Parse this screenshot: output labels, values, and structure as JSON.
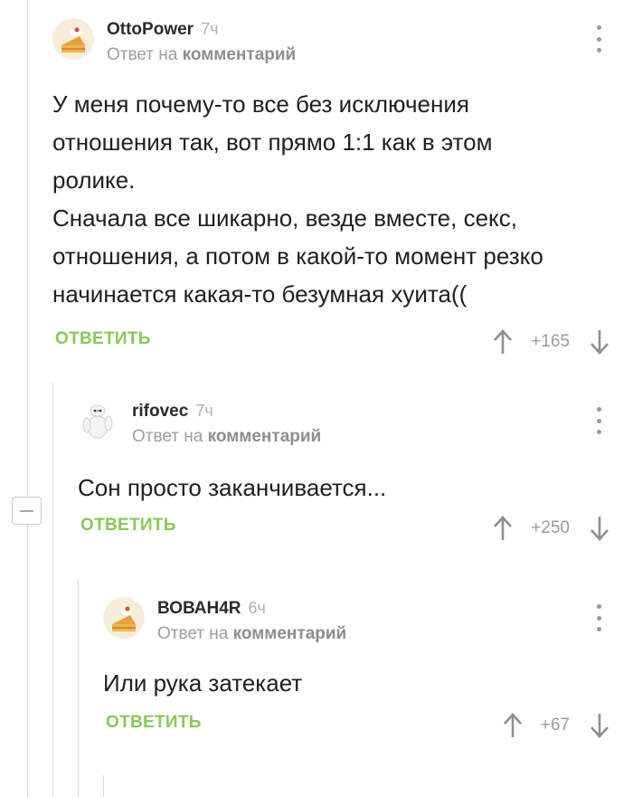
{
  "comments": [
    {
      "username": "OttoPower",
      "time": "7ч",
      "reply_prefix": "Ответ на",
      "reply_target": "комментарий",
      "lines": [
        "У меня почему-то все без исключения",
        "отношения так, вот прямо 1:1 как в этом",
        "ролике.",
        "Сначала все шикарно, везде вместе, секс,",
        "отношения, а потом в какой-то момент резко",
        "начинается какая-то безумная хуита(("
      ],
      "reply_label": "ОТВЕТИТЬ",
      "score": "+165",
      "avatar": "cake-slice-icon"
    },
    {
      "username": "rifovec",
      "time": "7ч",
      "reply_prefix": "Ответ на",
      "reply_target": "комментарий",
      "lines": [
        "Сон просто заканчивается..."
      ],
      "reply_label": "ОТВЕТИТЬ",
      "score": "+250",
      "avatar": "baymax-robot-icon"
    },
    {
      "username": "ВОВАН4R",
      "time": "6ч",
      "reply_prefix": "Ответ на",
      "reply_target": "комментарий",
      "lines": [
        "Или рука затекает"
      ],
      "reply_label": "ОТВЕТИТЬ",
      "score": "+67",
      "avatar": "cake-slice-icon"
    }
  ],
  "colors": {
    "accent_green": "#8ac858",
    "meta_gray": "#9e9e9e",
    "thread_line": "#dadada"
  }
}
